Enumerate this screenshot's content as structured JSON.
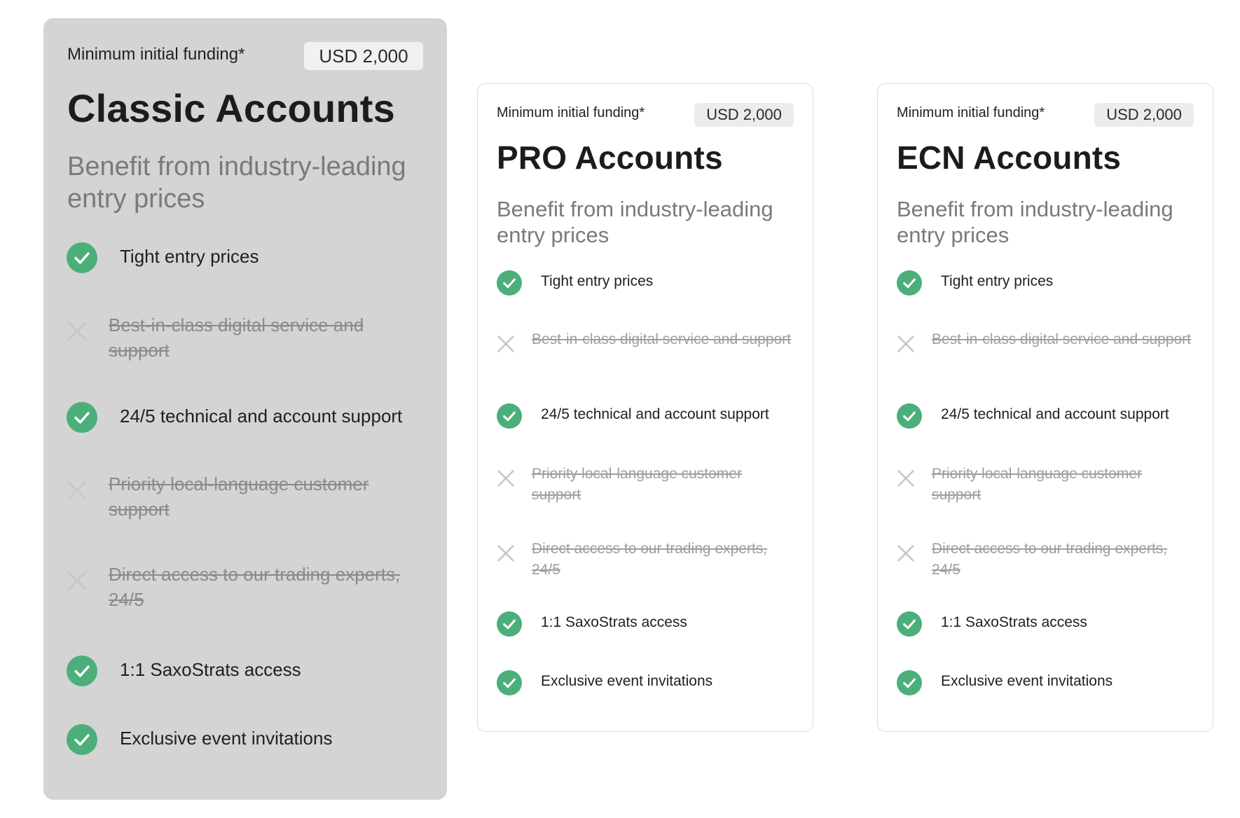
{
  "colors": {
    "check_green": "#4caf7a",
    "cross_gray": "#c8c8c8",
    "featured_bg": "#d4d4d4",
    "card_border": "#dcdcdc"
  },
  "icons": {
    "included": "check-circle-icon",
    "excluded": "cross-icon"
  },
  "plans": [
    {
      "id": "classic",
      "funding_label": "Minimum initial funding*",
      "price": "USD 2,000",
      "title": "Classic Accounts",
      "subtitle": "Benefit from industry-leading entry prices",
      "features": [
        {
          "text": "Tight entry prices",
          "included": true
        },
        {
          "text": "Best-in-class digital service and support",
          "included": false
        },
        {
          "text": "24/5 technical and account support",
          "included": true
        },
        {
          "text": "Priority local-language customer support",
          "included": false
        },
        {
          "text": "Direct access to our trading experts, 24/5",
          "included": false
        },
        {
          "text": "1:1 SaxoStrats access",
          "included": true
        },
        {
          "text": "Exclusive event invitations",
          "included": true
        }
      ]
    },
    {
      "id": "pro",
      "funding_label": "Minimum initial funding*",
      "price": "USD 2,000",
      "title": "PRO Accounts",
      "subtitle": "Benefit from industry-leading entry prices",
      "features": [
        {
          "text": "Tight entry prices",
          "included": true
        },
        {
          "text": "Best-in-class digital service and support",
          "included": false
        },
        {
          "text": "24/5 technical and account support",
          "included": true
        },
        {
          "text": "Priority local-language customer support",
          "included": false
        },
        {
          "text": "Direct access to our trading experts, 24/5",
          "included": false
        },
        {
          "text": "1:1 SaxoStrats access",
          "included": true
        },
        {
          "text": "Exclusive event invitations",
          "included": true
        }
      ]
    },
    {
      "id": "ecn",
      "funding_label": "Minimum initial funding*",
      "price": "USD 2,000",
      "title": "ECN Accounts",
      "subtitle": "Benefit from industry-leading entry prices",
      "features": [
        {
          "text": "Tight entry prices",
          "included": true
        },
        {
          "text": "Best-in-class digital service and support",
          "included": false
        },
        {
          "text": "24/5 technical and account support",
          "included": true
        },
        {
          "text": "Priority local-language customer support",
          "included": false
        },
        {
          "text": "Direct access to our trading experts, 24/5",
          "included": false
        },
        {
          "text": "1:1 SaxoStrats access",
          "included": true
        },
        {
          "text": "Exclusive event invitations",
          "included": true
        }
      ]
    }
  ]
}
